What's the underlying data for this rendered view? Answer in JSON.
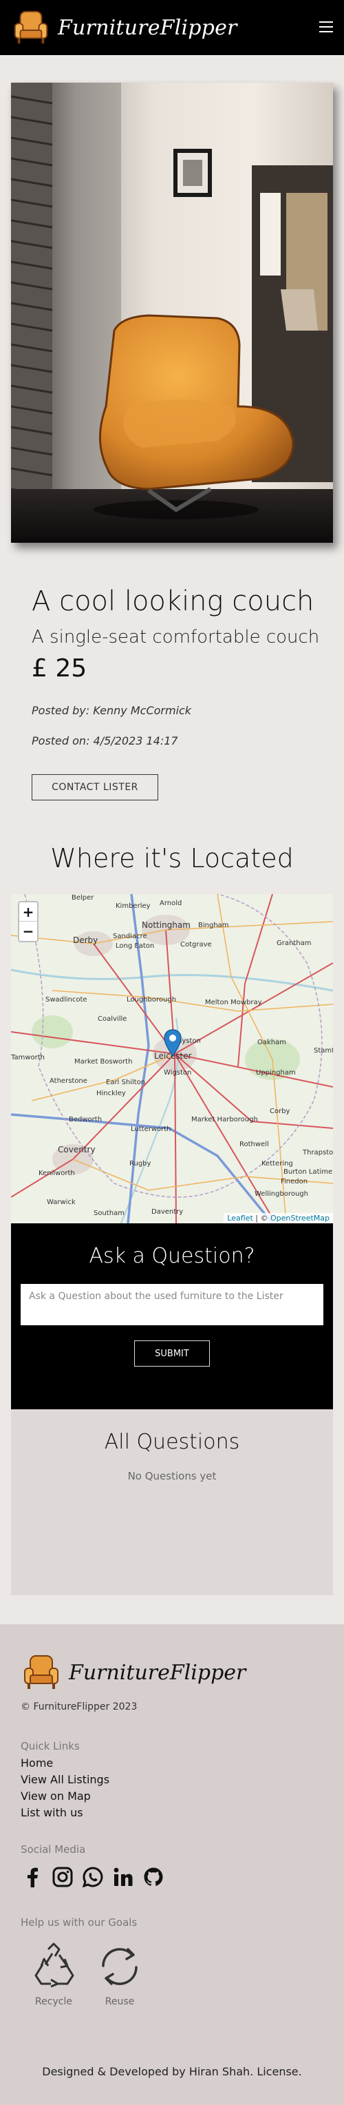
{
  "brand": {
    "name": "FurnitureFlipper"
  },
  "listing": {
    "title": "A cool looking couch",
    "subtitle": "A single-seat comfortable couch",
    "price": "£ 25",
    "posted_by": "Posted by: Kenny McCormick",
    "posted_on": "Posted on: 4/5/2023 14:17",
    "contact_label": "CONTACT LISTER"
  },
  "location": {
    "heading": "Where it's Located",
    "zoom_in": "+",
    "zoom_out": "−",
    "attribution_leaflet": "Leaflet",
    "attribution_sep": " | © ",
    "attribution_osm": "OpenStreetMap",
    "places": [
      "Belper",
      "Kimberley",
      "Arnold",
      "Nottingham",
      "Bingham",
      "Derby",
      "Sandiacre",
      "Long Eaton",
      "Cotgrave",
      "Grantham",
      "Swadlincote",
      "Loughborough",
      "Melton Mowbray",
      "Coalville",
      "Syston",
      "Leicester",
      "Oakham",
      "Market Bosworth",
      "Wigston",
      "Uppingham",
      "Tamworth",
      "Atherstone",
      "Earl Shilton",
      "Hinckley",
      "Corby",
      "Lutterworth",
      "Market Harborough",
      "Bedworth",
      "Coventry",
      "Rugby",
      "Kettering",
      "Burton Latimer",
      "Kenilworth",
      "Daventry",
      "Wellingborough",
      "Thrapston",
      "Rothwell",
      "Finedon",
      "Warwick",
      "Southam",
      "Stamford"
    ]
  },
  "ask": {
    "heading": "Ask a Question?",
    "placeholder": "Ask a Question about the used furniture to the Lister",
    "submit_label": "SUBMIT"
  },
  "questions": {
    "heading": "All Questions",
    "empty_text": "No Questions yet"
  },
  "footer": {
    "brand_name": "FurnitureFlipper",
    "copyright": "© FurnitureFlipper 2023",
    "quick_links_heading": "Quick Links",
    "quick_links": [
      "Home",
      "View All Listings",
      "View on Map",
      "List with us"
    ],
    "social_heading": "Social Media",
    "social_icons": [
      "facebook-icon",
      "instagram-icon",
      "whatsapp-icon",
      "linkedin-icon",
      "github-icon"
    ],
    "goals_heading": "Help us with our Goals",
    "goals": [
      "Recycle",
      "Reuse"
    ],
    "credit": "Designed & Developed by Hiran Shah. License."
  },
  "colors": {
    "navbar_bg": "#000000",
    "page_bg": "#ece8e6",
    "questions_bg": "#ded9d8",
    "footer_bg": "#d6cfcd",
    "marker": "#2a81cb",
    "chair": "#d98a2b"
  }
}
